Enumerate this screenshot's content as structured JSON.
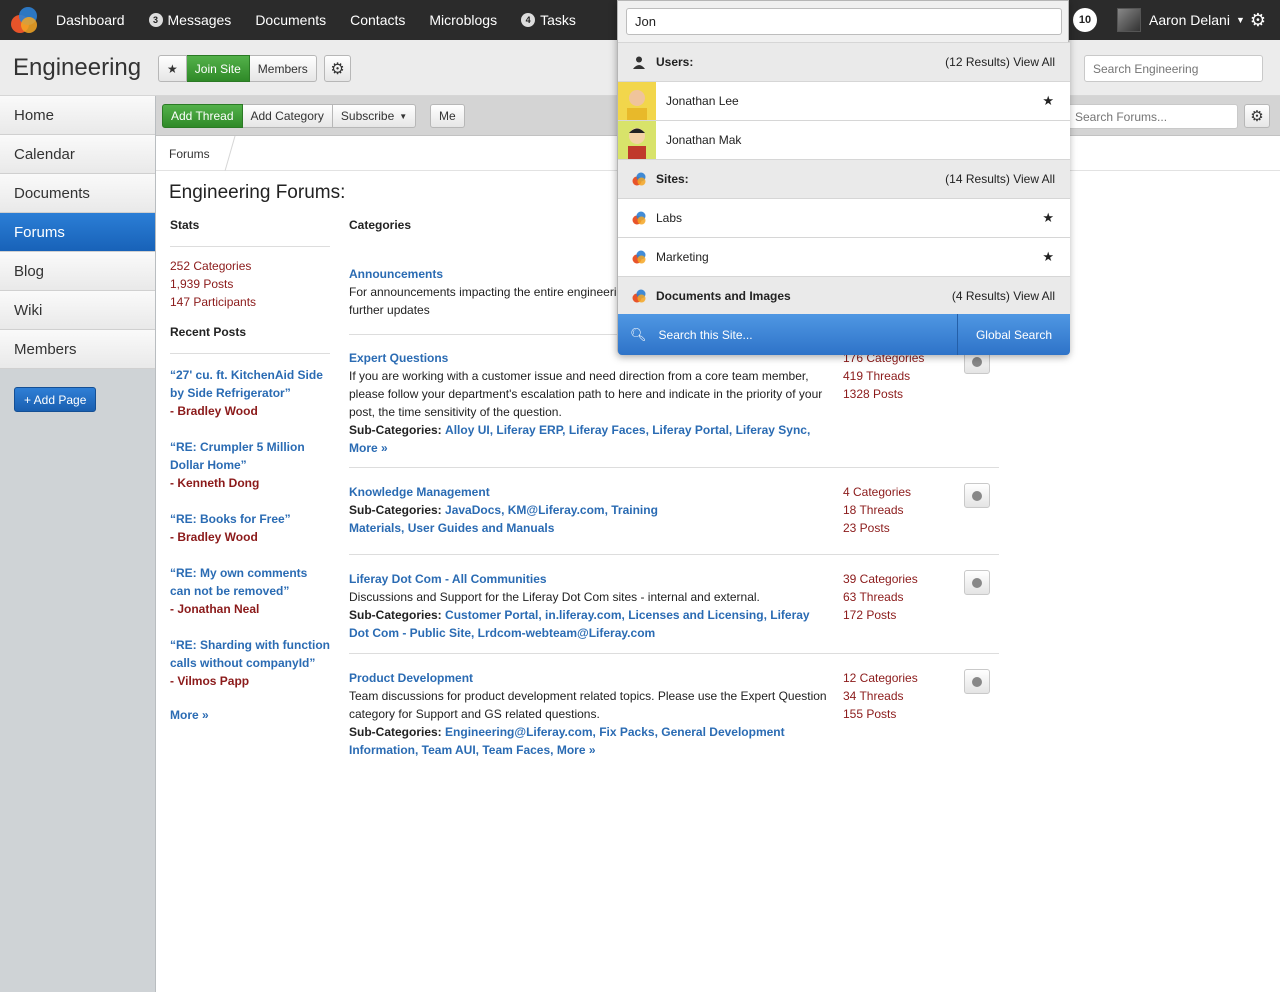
{
  "topbar": {
    "nav": [
      {
        "label": "Dashboard",
        "badge": ""
      },
      {
        "label": "Messages",
        "badge": "3"
      },
      {
        "label": "Documents",
        "badge": ""
      },
      {
        "label": "Contacts",
        "badge": ""
      },
      {
        "label": "Microblogs",
        "badge": ""
      },
      {
        "label": "Tasks",
        "badge": "4"
      }
    ],
    "notification_count": "10",
    "user_name": "Aaron Delani"
  },
  "site": {
    "title": "Engineering",
    "star": "★",
    "join_label": "Join Site",
    "members_label": "Members",
    "search_placeholder": "Search Engineering"
  },
  "sidebar": {
    "items": [
      "Home",
      "Calendar",
      "Documents",
      "Forums",
      "Blog",
      "Wiki",
      "Members"
    ],
    "active": "Forums",
    "add_page": "+ Add Page"
  },
  "toolbar": {
    "add_thread": "Add Thread",
    "add_category": "Add Category",
    "subscribe": "Subscribe",
    "me": "Me",
    "search_placeholder": "Search Forums..."
  },
  "breadcrumb": "Forums",
  "forum": {
    "title": "Engineering Forums:",
    "stats_head": "Stats",
    "categories_head": "Categories",
    "stats": [
      "252 Categories",
      "1,939 Posts",
      "147 Participants"
    ],
    "recent_head": "Recent Posts",
    "recent_posts": [
      {
        "title": "“27' cu. ft. KitchenAid Side by Side Refrigerator”",
        "author": "- Bradley Wood"
      },
      {
        "title": "“RE: Crumpler 5 Million Dollar Home”",
        "author": "- Kenneth Dong"
      },
      {
        "title": "“RE: Books for Free”",
        "author": "- Bradley Wood"
      },
      {
        "title": "“RE: My own comments can not be removed”",
        "author": "- Jonathan Neal"
      },
      {
        "title": "“RE: Sharding with function calls without companyId”",
        "author": "- Vilmos Papp"
      }
    ],
    "more": "More »",
    "subcat_label": "Sub-Categories:",
    "categories": [
      {
        "name": "Announcements",
        "desc": "For announcements impacting the entire engineering organization. Subscribe to get further updates",
        "subcats": "",
        "stats": []
      },
      {
        "name": "Expert Questions",
        "desc": "If you are working with a customer issue and need direction from a core team member, please follow your department's escalation path to here and indicate in the priority of your post, the time sensitivity of the question.",
        "subcats": "Alloy UI, Liferay ERP, Liferay Faces, Liferay Portal, Liferay Sync, More »",
        "stats": [
          "176 Categories",
          "419 Threads",
          "1328 Posts"
        ]
      },
      {
        "name": "Knowledge Management",
        "desc": "",
        "subcats": "JavaDocs, KM@Liferay.com, Training Materials, User Guides and Manuals",
        "stats": [
          "4 Categories",
          "18 Threads",
          "23 Posts"
        ]
      },
      {
        "name": "Liferay Dot Com - All Communities",
        "desc": "Discussions and Support for the Liferay Dot Com sites - internal and external.",
        "subcats": "Customer Portal, in.liferay.com, Licenses and Licensing, Liferay Dot Com - Public Site, Lrdcom-webteam@Liferay.com",
        "stats": [
          "39 Categories",
          "63 Threads",
          "172 Posts"
        ]
      },
      {
        "name": "Product Development",
        "desc": "Team discussions for product development related topics. Please use the Expert Question category for Support and GS related questions.",
        "subcats": "Engineering@Liferay.com, Fix Packs, General Development Information, Team AUI, Team Faces, More »",
        "stats": [
          "12 Categories",
          "34 Threads",
          "155 Posts"
        ]
      }
    ]
  },
  "search_popup": {
    "query": "Jon",
    "users_label": "Users:",
    "users_count": "(12 Results) View All",
    "users": [
      "Jonathan Lee",
      "Jonathan Mak"
    ],
    "sites_label": "Sites:",
    "sites_count": "(14 Results) View All",
    "sites": [
      "Labs",
      "Marketing"
    ],
    "docs_label": "Documents and Images",
    "docs_count": "(4 Results) View All",
    "search_site": "Search this Site...",
    "global_search": "Global Search",
    "star": "★"
  },
  "colors": {
    "topbar": "#2b2b2b",
    "accent_blue": "#2a6bb3",
    "accent_green": "#3a9a32",
    "stat_red": "#8b1a1a"
  }
}
